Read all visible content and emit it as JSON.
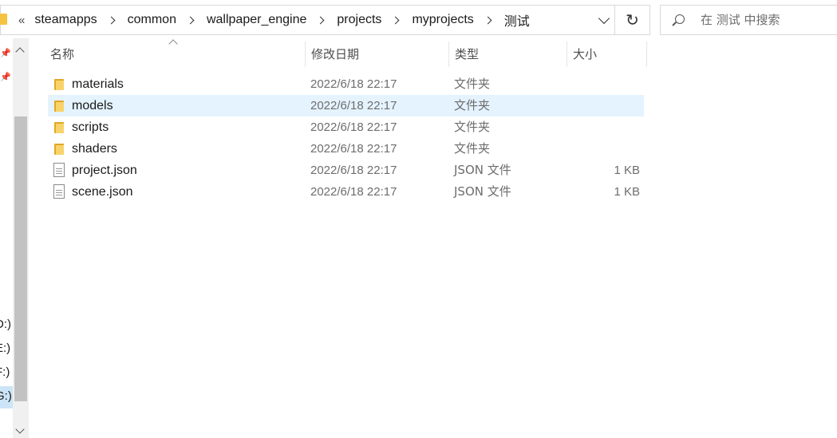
{
  "address": {
    "overflow_glyph": "«",
    "crumbs": [
      "steamapps",
      "common",
      "wallpaper_engine",
      "projects",
      "myprojects",
      "测试"
    ],
    "refresh_glyph": "↻"
  },
  "search": {
    "placeholder": "在 测试 中搜索"
  },
  "columns": {
    "name": "名称",
    "date": "修改日期",
    "type": "类型",
    "size": "大小"
  },
  "files": [
    {
      "name": "materials",
      "date": "2022/6/18 22:17",
      "type": "文件夹",
      "size": "",
      "icon": "folder-icon"
    },
    {
      "name": "models",
      "date": "2022/6/18 22:17",
      "type": "文件夹",
      "size": "",
      "icon": "folder-icon"
    },
    {
      "name": "scripts",
      "date": "2022/6/18 22:17",
      "type": "文件夹",
      "size": "",
      "icon": "folder-icon"
    },
    {
      "name": "shaders",
      "date": "2022/6/18 22:17",
      "type": "文件夹",
      "size": "",
      "icon": "folder-icon"
    },
    {
      "name": "project.json",
      "date": "2022/6/18 22:17",
      "type": "JSON 文件",
      "size": "1 KB",
      "icon": "json-file-icon"
    },
    {
      "name": "scene.json",
      "date": "2022/6/18 22:17",
      "type": "JSON 文件",
      "size": "1 KB",
      "icon": "json-file-icon"
    }
  ],
  "nav_drives": [
    "D:)",
    "E:)",
    "F:)",
    "G:)"
  ],
  "colors": {
    "selection": "#e5f3ff",
    "folder": "#f8d36a",
    "scroll_thumb": "#c2c2c2"
  }
}
